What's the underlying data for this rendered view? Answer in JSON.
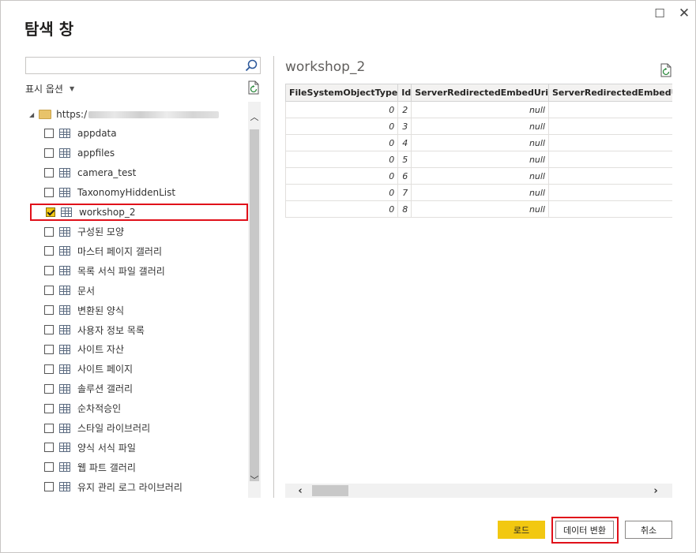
{
  "window": {
    "title": "탐색 창",
    "maximize_glyph": "☐",
    "close_glyph": "✕"
  },
  "left": {
    "search": {
      "value": "",
      "placeholder": ""
    },
    "options_label": "표시 옵션",
    "root_label": "https:/",
    "items": [
      {
        "label": "appdata",
        "checked": false
      },
      {
        "label": "appfiles",
        "checked": false
      },
      {
        "label": "camera_test",
        "checked": false
      },
      {
        "label": "TaxonomyHiddenList",
        "checked": false
      },
      {
        "label": "workshop_2",
        "checked": true
      },
      {
        "label": "구성된 모양",
        "checked": false
      },
      {
        "label": "마스터 페이지 갤러리",
        "checked": false
      },
      {
        "label": "목록 서식 파일 갤러리",
        "checked": false
      },
      {
        "label": "문서",
        "checked": false
      },
      {
        "label": "변환된 양식",
        "checked": false
      },
      {
        "label": "사용자 정보 목록",
        "checked": false
      },
      {
        "label": "사이트 자산",
        "checked": false
      },
      {
        "label": "사이트 페이지",
        "checked": false
      },
      {
        "label": "솔루션 갤러리",
        "checked": false
      },
      {
        "label": "순차적승인",
        "checked": false
      },
      {
        "label": "스타일 라이브러리",
        "checked": false
      },
      {
        "label": "양식 서식 파일",
        "checked": false
      },
      {
        "label": "웹 파트 갤러리",
        "checked": false
      },
      {
        "label": "유지 관리 로그 라이브러리",
        "checked": false
      }
    ]
  },
  "preview": {
    "title": "workshop_2",
    "columns": [
      "FileSystemObjectType",
      "Id",
      "ServerRedirectedEmbedUri",
      "ServerRedirectedEmbedU"
    ],
    "rows": [
      [
        "0",
        "2",
        "null",
        ""
      ],
      [
        "0",
        "3",
        "null",
        ""
      ],
      [
        "0",
        "4",
        "null",
        ""
      ],
      [
        "0",
        "5",
        "null",
        ""
      ],
      [
        "0",
        "6",
        "null",
        ""
      ],
      [
        "0",
        "7",
        "null",
        ""
      ],
      [
        "0",
        "8",
        "null",
        ""
      ]
    ]
  },
  "buttons": {
    "load": "로드",
    "transform": "데이터 변환",
    "cancel": "취소"
  },
  "colors": {
    "accent": "#f2c811",
    "highlight": "#e0101a"
  }
}
